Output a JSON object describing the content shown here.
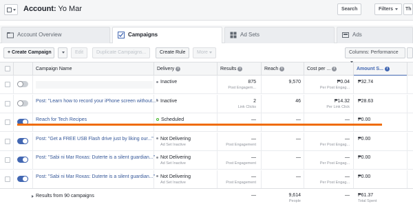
{
  "header": {
    "account_label": "Account:",
    "account_name": "Yo Mar",
    "search_label": "Search",
    "filters_label": "Filters",
    "overflow_label": "Th"
  },
  "tabs": [
    {
      "label": "Account Overview",
      "icon": "folder-icon"
    },
    {
      "label": "Campaigns",
      "icon": "checkbox-icon"
    },
    {
      "label": "Ad Sets",
      "icon": "grid-icon"
    },
    {
      "label": "Ads",
      "icon": "ad-icon"
    }
  ],
  "toolbar": {
    "create_campaign": "+ Create Campaign",
    "edit": "Edit",
    "duplicate": "Duplicate Campaigns...",
    "create_rule": "Create Rule",
    "more": "More",
    "columns": "Columns: Performance"
  },
  "columns": {
    "name": "Campaign Name",
    "delivery": "Delivery",
    "results": "Results",
    "reach": "Reach",
    "cost": "Cost per ...",
    "amount": "Amount S..."
  },
  "rows": [
    {
      "name": "",
      "toggle": "off",
      "delivery": "Inactive",
      "delivery_sub": "",
      "results": "875",
      "results_sub": "Post Engagem...",
      "reach": "9,570",
      "cost": "₱0.04",
      "cost_sub": "Per Post Engag...",
      "amount": "₱32.74",
      "amount_sub": ""
    },
    {
      "name": "Post: \"Learn how to record your iPhone screen without...\"",
      "toggle": "off",
      "delivery": "Inactive",
      "delivery_sub": "",
      "results": "2",
      "results_sub": "Link Clicks",
      "reach": "46",
      "cost": "₱14.32",
      "cost_sub": "Per Link Click",
      "amount": "₱28.63",
      "amount_sub": ""
    },
    {
      "name": "Reach for Tech Recipes",
      "toggle": "on",
      "delivery": "Scheduled",
      "delivery_sub": "",
      "results": "—",
      "results_sub": "",
      "reach": "—",
      "cost": "—",
      "cost_sub": "",
      "amount": "₱0.00",
      "amount_sub": ""
    },
    {
      "name": "Post: \"Get a FREE USB Flash drive just by liking our...\"",
      "toggle": "on",
      "delivery": "Not Delivering",
      "delivery_sub": "Ad Set Inactive",
      "results": "—",
      "results_sub": "Post Engagement",
      "reach": "—",
      "cost": "—",
      "cost_sub": "Per Post Engag...",
      "amount": "₱0.00",
      "amount_sub": ""
    },
    {
      "name": "Post: \"Sabi ni Mar Roxas: Duterte is a silent guardian...\"",
      "toggle": "on",
      "delivery": "Not Delivering",
      "delivery_sub": "Ad Set Inactive",
      "results": "—",
      "results_sub": "Post Engagement",
      "reach": "—",
      "cost": "—",
      "cost_sub": "Per Post Engag...",
      "amount": "₱0.00",
      "amount_sub": ""
    },
    {
      "name": "Post: \"Sabi ni Mar Roxas: Duterte is a silent guardian...\"",
      "toggle": "on",
      "delivery": "Not Delivering",
      "delivery_sub": "Ad Set Inactive",
      "results": "—",
      "results_sub": "Post Engagement",
      "reach": "—",
      "cost": "—",
      "cost_sub": "Per Post Engag...",
      "amount": "₱0.00",
      "amount_sub": ""
    }
  ],
  "footer": {
    "label": "Results from 90 campaigns",
    "results": "—",
    "reach": "9,614",
    "reach_sub": "People",
    "cost": "—",
    "amount": "₱61.37",
    "amount_sub": "Total Spent"
  },
  "colors": {
    "accent": "#4267b2",
    "annotation": "#ef6b00"
  }
}
